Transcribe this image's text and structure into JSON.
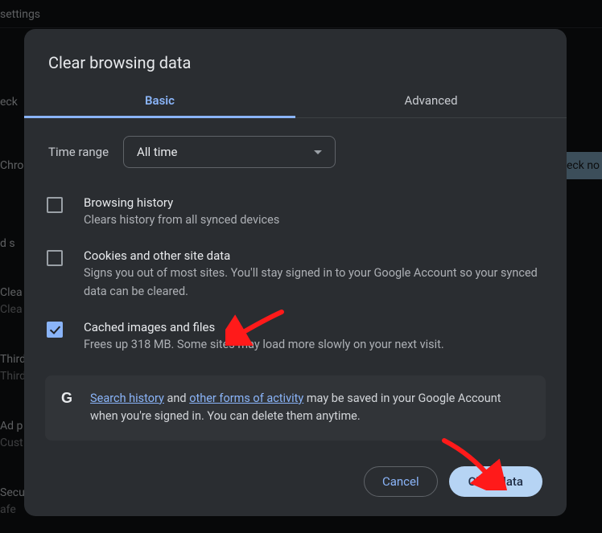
{
  "background": {
    "top_tab": "settings",
    "left": [
      "eck",
      "Chro",
      "d s",
      "Clea",
      "Clea",
      "Third",
      "Third",
      "Ad p",
      "Cust",
      "Secu",
      "afe"
    ],
    "check_btn": "eck no"
  },
  "modal": {
    "title": "Clear browsing data",
    "tabs": {
      "basic": "Basic",
      "advanced": "Advanced"
    },
    "time_range_label": "Time range",
    "time_range_value": "All time",
    "options": [
      {
        "title": "Browsing history",
        "desc": "Clears history from all synced devices",
        "checked": false
      },
      {
        "title": "Cookies and other site data",
        "desc": "Signs you out of most sites. You'll stay signed in to your Google Account so your synced data can be cleared.",
        "checked": false
      },
      {
        "title": "Cached images and files",
        "desc": "Frees up 318 MB. Some sites may load more slowly on your next visit.",
        "checked": true
      }
    ],
    "info": {
      "link1": "Search history",
      "mid": " and ",
      "link2": "other forms of activity",
      "rest": " may be saved in your Google Account when you're signed in. You can delete them anytime."
    },
    "actions": {
      "cancel": "Cancel",
      "clear": "Clear data"
    }
  }
}
